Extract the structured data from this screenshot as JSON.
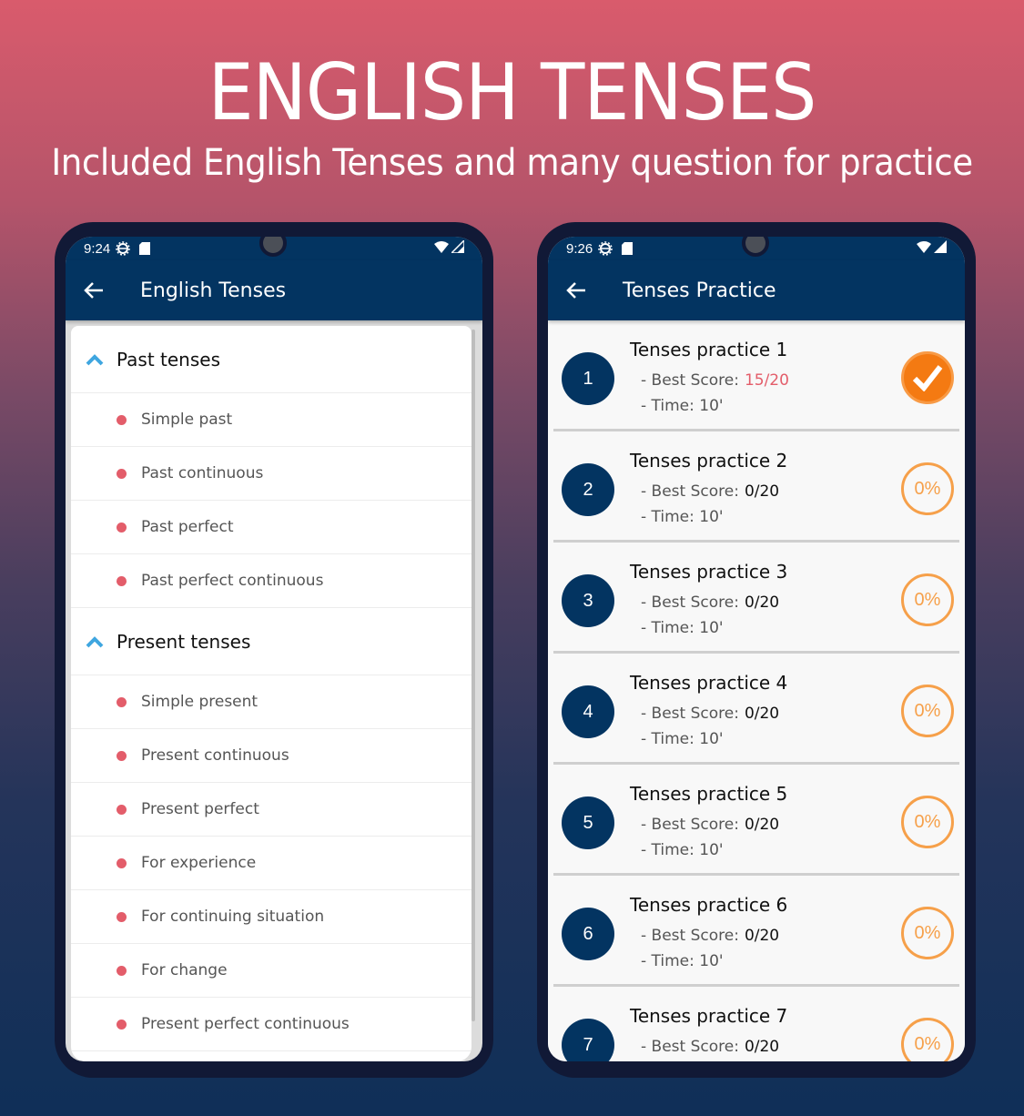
{
  "hero": {
    "title": "ENGLISH TENSES",
    "subtitle": "Included English Tenses and many question for practice"
  },
  "left_phone": {
    "status_bar": {
      "time": "9:24",
      "icons": [
        "settings-icon",
        "sd-card-icon",
        "wifi-icon",
        "signal-icon"
      ]
    },
    "app_bar": {
      "title": "English Tenses",
      "back_icon": "arrow-left-icon"
    },
    "groups": [
      {
        "label": "Past tenses",
        "expanded": true,
        "items": [
          {
            "label": "Simple past"
          },
          {
            "label": "Past continuous"
          },
          {
            "label": "Past perfect"
          },
          {
            "label": "Past perfect continuous"
          }
        ]
      },
      {
        "label": "Present tenses",
        "expanded": true,
        "items": [
          {
            "label": "Simple present"
          },
          {
            "label": "Present continuous"
          },
          {
            "label": "Present perfect"
          },
          {
            "label": "For experience"
          },
          {
            "label": "For continuing situation"
          },
          {
            "label": "For change"
          },
          {
            "label": "Present perfect continuous"
          }
        ]
      }
    ]
  },
  "right_phone": {
    "status_bar": {
      "time": "9:26",
      "icons": [
        "settings-icon",
        "sd-card-icon",
        "wifi-icon",
        "signal-icon"
      ]
    },
    "app_bar": {
      "title": "Tenses Practice",
      "back_icon": "arrow-left-icon"
    },
    "best_score_label": "- Best Score:",
    "time_label": "- Time:",
    "practices": [
      {
        "number": "1",
        "title": "Tenses practice 1",
        "best_score": "15/20",
        "time": "10'",
        "status": "completed",
        "status_text": ""
      },
      {
        "number": "2",
        "title": "Tenses practice 2",
        "best_score": "0/20",
        "time": "10'",
        "status": "percent",
        "status_text": "0%"
      },
      {
        "number": "3",
        "title": "Tenses practice 3",
        "best_score": "0/20",
        "time": "10'",
        "status": "percent",
        "status_text": "0%"
      },
      {
        "number": "4",
        "title": "Tenses practice 4",
        "best_score": "0/20",
        "time": "10'",
        "status": "percent",
        "status_text": "0%"
      },
      {
        "number": "5",
        "title": "Tenses practice 5",
        "best_score": "0/20",
        "time": "10'",
        "status": "percent",
        "status_text": "0%"
      },
      {
        "number": "6",
        "title": "Tenses practice 6",
        "best_score": "0/20",
        "time": "10'",
        "status": "percent",
        "status_text": "0%"
      },
      {
        "number": "7",
        "title": "Tenses practice 7",
        "best_score": "0/20",
        "time": "",
        "status": "percent",
        "status_text": "0%"
      }
    ]
  },
  "colors": {
    "primary": "#033461",
    "accent_blue": "#3fa6e0",
    "bullet_red": "#e35d6a",
    "orange": "#f47a12",
    "orange_light": "#f6a04a"
  }
}
